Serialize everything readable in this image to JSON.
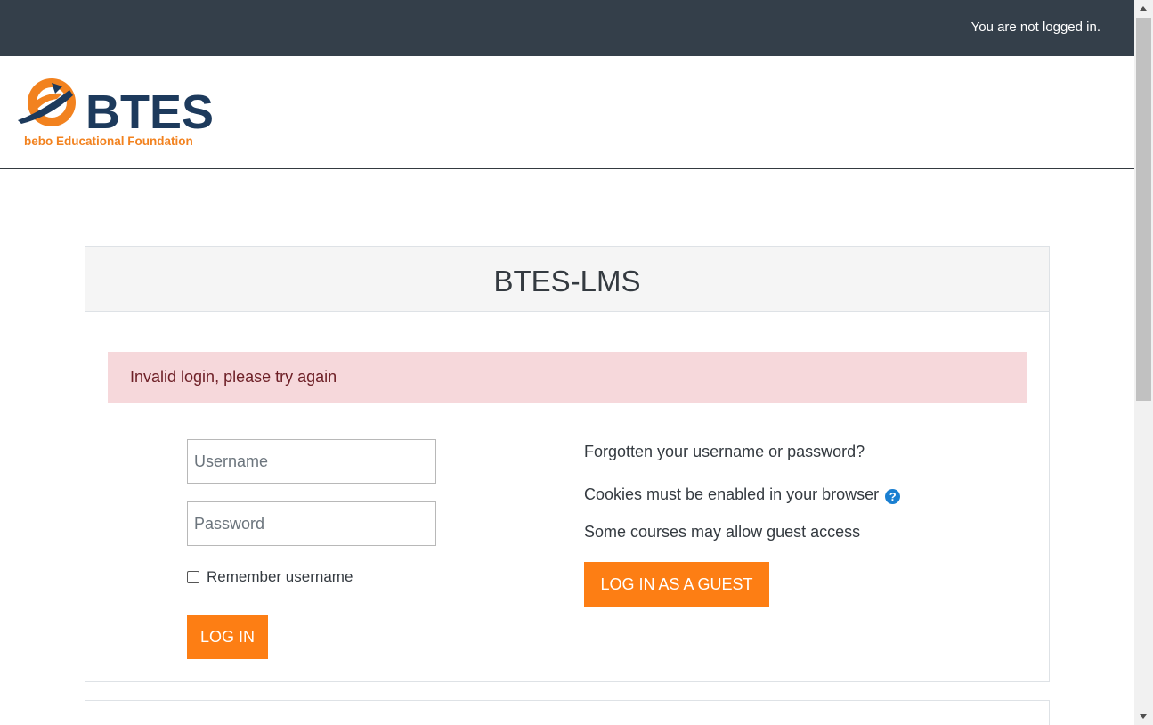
{
  "topbar": {
    "login_status": "You are not logged in."
  },
  "logo": {
    "name": "BTES",
    "tagline": "bebo Educational Foundation",
    "brand_blue": "#1d3a5c",
    "brand_orange": "#f2821f"
  },
  "login": {
    "site_title": "BTES-LMS",
    "error_message": "Invalid login, please try again",
    "username_placeholder": "Username",
    "password_placeholder": "Password",
    "remember_label": "Remember username",
    "remember_checked": false,
    "login_button": "LOG IN"
  },
  "help": {
    "forgot_link": "Forgotten your username or password?",
    "cookies_text": "Cookies must be enabled in your browser",
    "help_icon": "question-circle-icon",
    "guest_text": "Some courses may allow guest access",
    "guest_button": "LOG IN AS A GUEST"
  },
  "colors": {
    "topbar": "#343f4a",
    "accent": "#fd7e14",
    "alert_bg": "#f6d8db",
    "alert_text": "#6e2027",
    "help_icon": "#1a7fd1"
  }
}
